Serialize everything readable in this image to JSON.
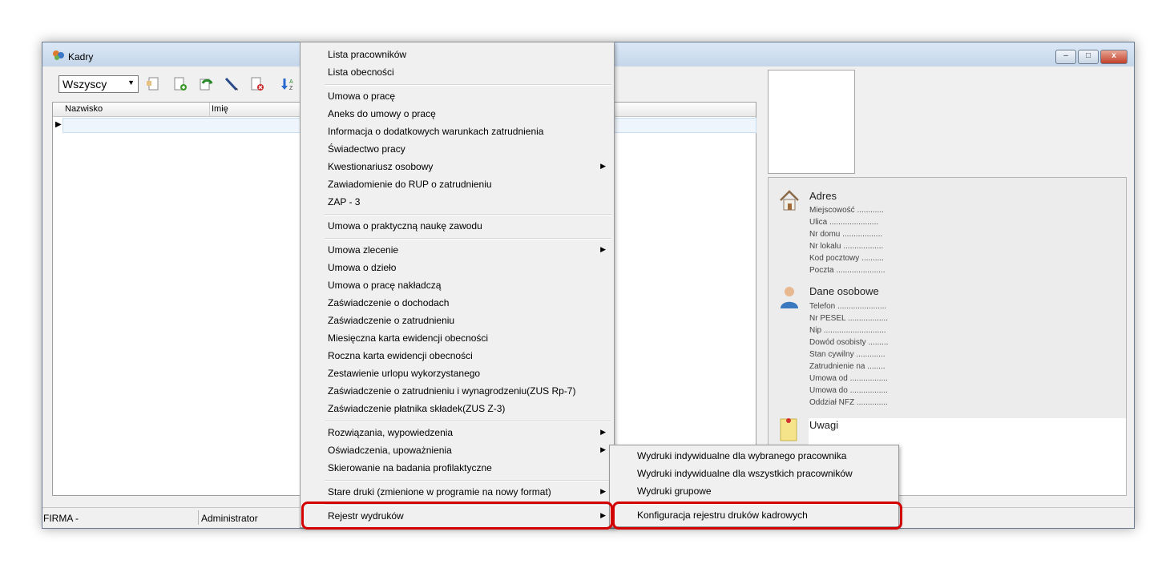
{
  "window": {
    "title": "Kadry",
    "controls": {
      "minimize": "–",
      "maximize": "□",
      "close": "x"
    }
  },
  "toolbar": {
    "filter_value": "Wszyscy",
    "icons": [
      "document-icon",
      "add-document-icon",
      "refresh-icon",
      "edit-pen-icon",
      "delete-document-icon",
      "sort-az-icon"
    ]
  },
  "grid": {
    "columns": [
      "Nazwisko",
      "Imię"
    ]
  },
  "details": {
    "address_title": "Adres",
    "address_fields": [
      "Miejscowość ............",
      "Ulica ......................",
      "Nr domu ..................",
      "Nr lokalu ..................",
      "Kod pocztowy ..........",
      "Poczta ......................"
    ],
    "personal_title": "Dane osobowe",
    "personal_fields": [
      "Telefon ......................",
      "Nr PESEL ..................",
      "Nip ............................",
      "Dowód osobisty .........",
      "Stan cywilny .............",
      "Zatrudnienie na  ........",
      "Umowa od .................",
      "Umowa do .................",
      "Oddział NFZ .............."
    ],
    "notes_title": "Uwagi"
  },
  "statusbar": {
    "company": "FIRMA -",
    "user": "Administrator"
  },
  "context_menu": {
    "items": [
      "Lista pracowników",
      "Lista obecności",
      "Umowa o pracę",
      "Aneks do umowy o pracę",
      "Informacja o dodatkowych warunkach zatrudnienia",
      "Świadectwo pracy",
      "Kwestionariusz osobowy",
      "Zawiadomienie do RUP o zatrudnieniu",
      "ZAP - 3",
      "Umowa o praktyczną naukę zawodu",
      "Umowa zlecenie",
      "Umowa o dzieło",
      "Umowa o pracę nakładczą",
      "Zaświadczenie o dochodach",
      "Zaświadczenie o zatrudnieniu",
      "Miesięczna karta ewidencji obecności",
      "Roczna karta ewidencji obecności",
      "Zestawienie urlopu wykorzystanego",
      "Zaświadczenie o zatrudnieniu i wynagrodzeniu(ZUS Rp-7)",
      "Zaświadczenie płatnika składek(ZUS Z-3)",
      "Rozwiązania, wypowiedzenia",
      "Oświadczenia, upoważnienia",
      "Skierowanie na badania profilaktyczne",
      "Stare druki (zmienione w programie na nowy format)",
      "Rejestr wydruków"
    ]
  },
  "submenu": {
    "items": [
      "Wydruki indywidualne dla wybranego pracownika",
      "Wydruki indywidualne dla wszystkich pracowników",
      "Wydruki grupowe",
      "Konfiguracja rejestru druków kadrowych"
    ]
  },
  "colors": {
    "highlight": "#d20000",
    "titlebar": "#c5d6ea"
  }
}
